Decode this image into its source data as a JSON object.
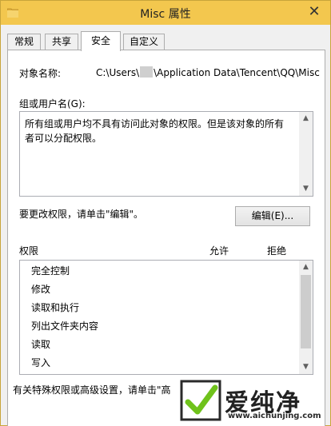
{
  "window": {
    "title": "Misc 属性"
  },
  "tabs": [
    {
      "label": "常规",
      "active": false
    },
    {
      "label": "共享",
      "active": false
    },
    {
      "label": "安全",
      "active": true
    },
    {
      "label": "自定义",
      "active": false
    }
  ],
  "security": {
    "object_name_label": "对象名称:",
    "object_path_prefix": "C:\\Users\\",
    "object_path_suffix": "\\Application Data\\Tencent\\QQ\\Misc",
    "group_label": "组或用户名(G):",
    "group_message": "所有组或用户均不具有访问此对象的权限。但是该对象的所有者可以分配权限。",
    "change_text": "要更改权限，请单击\"编辑\"。",
    "edit_button": "编辑(E)...",
    "perm_header": "权限",
    "allow_header": "允许",
    "deny_header": "拒绝",
    "permissions": [
      "完全控制",
      "修改",
      "读取和执行",
      "列出文件夹内容",
      "读取",
      "写入"
    ],
    "bottom_text": "有关特殊权限或高级设置，请单击\"高"
  },
  "watermark": {
    "brand": "爱纯净",
    "url": "www.aichunjing.com"
  },
  "colors": {
    "titlebar": "#f3c74e",
    "panel": "#ffffff",
    "window": "#f0f0f0"
  }
}
